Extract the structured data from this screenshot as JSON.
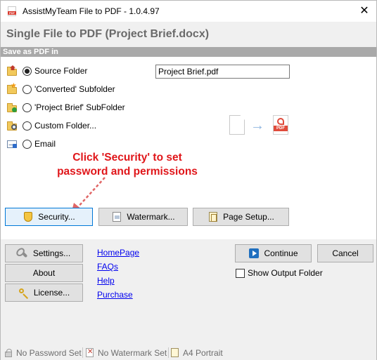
{
  "window": {
    "title": "AssistMyTeam File to PDF - 1.0.4.97",
    "app_icon_text": "PDF",
    "close_symbol": "✕"
  },
  "header": {
    "title": "Single File to PDF (Project Brief.docx)"
  },
  "section": {
    "label": "Save as PDF in"
  },
  "save_options": [
    {
      "label": "Source Folder",
      "checked": true,
      "icon": "folder-home-icon"
    },
    {
      "label": "'Converted' Subfolder",
      "checked": false,
      "icon": "folder-star-icon"
    },
    {
      "label": "'Project Brief' SubFolder",
      "checked": false,
      "icon": "folder-add-icon"
    },
    {
      "label": "Custom Folder...",
      "checked": false,
      "icon": "folder-search-icon"
    },
    {
      "label": "Email",
      "checked": false,
      "icon": "email-icon"
    }
  ],
  "filename": {
    "value": "Project Brief.pdf"
  },
  "conversion_graphic": {
    "arrow": "→",
    "pdf_label": "PDF"
  },
  "callout": {
    "line1": "Click 'Security' to set",
    "line2": "password and permissions",
    "color": "#e0161a"
  },
  "actions": {
    "security": "Security...",
    "watermark": "Watermark...",
    "page_setup": "Page Setup..."
  },
  "left_buttons": {
    "settings": "Settings...",
    "about": "About",
    "license": "License..."
  },
  "links": [
    "HomePage",
    "FAQs",
    "Help",
    "Purchase"
  ],
  "main_buttons": {
    "continue": "Continue",
    "cancel": "Cancel"
  },
  "show_output_folder": {
    "label": "Show Output Folder",
    "checked": false
  },
  "status": {
    "password": "No Password Set",
    "watermark": "No Watermark Set",
    "page": "A4 Portrait"
  },
  "colors": {
    "accent": "#0078d7",
    "link": "#0000ee",
    "section_bar": "#a9a9a9"
  }
}
